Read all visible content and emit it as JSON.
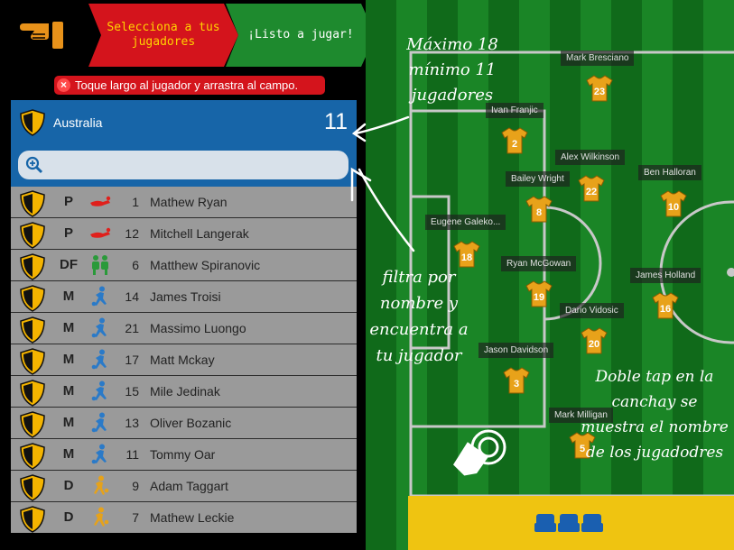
{
  "header": {
    "step1_label": "Selecciona a tus jugadores",
    "step2_label": "¡Listo a jugar!",
    "hint": "Toque largo al jugador y arrastra al campo.",
    "hint_close": "×"
  },
  "team": {
    "name": "Australia",
    "count": "11",
    "search_placeholder": ""
  },
  "players_list": [
    {
      "position": "P",
      "number": "1",
      "name": "Mathew Ryan",
      "icon": "goalkeeper-icon"
    },
    {
      "position": "P",
      "number": "12",
      "name": "Mitchell Langerak",
      "icon": "goalkeeper-icon"
    },
    {
      "position": "DF",
      "number": "6",
      "name": "Matthew Spiranovic",
      "icon": "defender-icon"
    },
    {
      "position": "M",
      "number": "14",
      "name": "James Troisi",
      "icon": "midfielder-icon"
    },
    {
      "position": "M",
      "number": "21",
      "name": "Massimo Luongo",
      "icon": "midfielder-icon"
    },
    {
      "position": "M",
      "number": "17",
      "name": "Matt Mckay",
      "icon": "midfielder-icon"
    },
    {
      "position": "M",
      "number": "15",
      "name": "Mile Jedinak",
      "icon": "midfielder-icon"
    },
    {
      "position": "M",
      "number": "13",
      "name": "Oliver Bozanic",
      "icon": "midfielder-icon"
    },
    {
      "position": "M",
      "number": "11",
      "name": "Tommy Oar",
      "icon": "midfielder-icon"
    },
    {
      "position": "D",
      "number": "9",
      "name": "Adam Taggart",
      "icon": "forward-icon"
    },
    {
      "position": "D",
      "number": "7",
      "name": "Mathew Leckie",
      "icon": "forward-icon"
    }
  ],
  "field_players": [
    {
      "name": "Mark Bresciano",
      "number": "23"
    },
    {
      "name": "Ivan Franjic",
      "number": "2"
    },
    {
      "name": "Alex Wilkinson",
      "number": "22"
    },
    {
      "name": "Ben Halloran",
      "number": "10"
    },
    {
      "name": "Bailey Wright",
      "number": "8"
    },
    {
      "name": "Eugene Galeko...",
      "number": "18"
    },
    {
      "name": "Ryan McGowan",
      "number": "19"
    },
    {
      "name": "James Holland",
      "number": "16"
    },
    {
      "name": "Dario Vidosic",
      "number": "20"
    },
    {
      "name": "Jason Davidson",
      "number": "3"
    },
    {
      "name": "Mark Milligan",
      "number": "5"
    }
  ],
  "annotations": {
    "max_players": "Máximo 18\nmínimo 11\njugadores",
    "filter": "filtra por\nnombre y\nencuentra a\ntu jugador",
    "double_tap": "Doble tap en la\ncanchay se\nmuestra el nombre\nde los jugadodres"
  },
  "colors": {
    "step1": "#d4141c",
    "step2": "#1e8a2e",
    "team_header": "#1765a8",
    "jersey": "#e8a21a",
    "bench": "#efc411"
  }
}
